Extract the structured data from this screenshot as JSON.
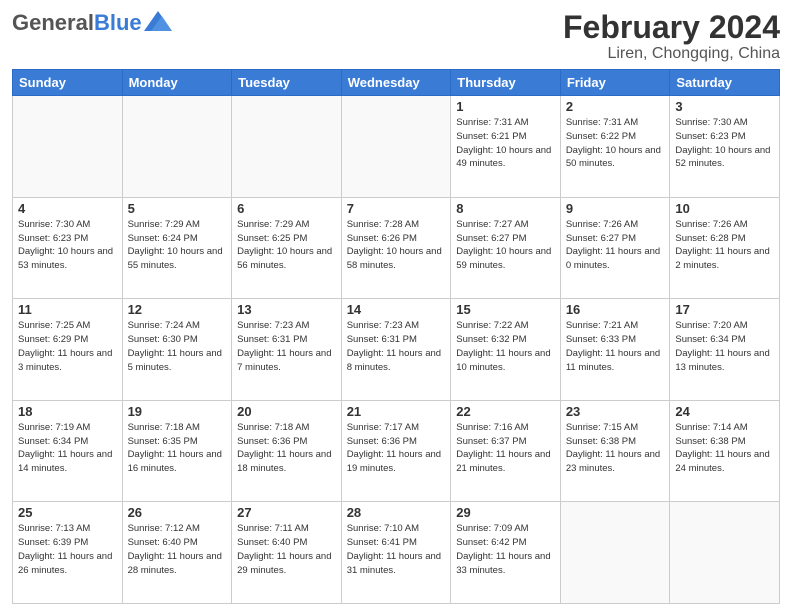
{
  "header": {
    "logo_general": "General",
    "logo_blue": "Blue",
    "title": "February 2024",
    "subtitle": "Liren, Chongqing, China"
  },
  "days_of_week": [
    "Sunday",
    "Monday",
    "Tuesday",
    "Wednesday",
    "Thursday",
    "Friday",
    "Saturday"
  ],
  "weeks": [
    {
      "alt": false,
      "days": [
        {
          "num": "",
          "info": "",
          "empty": true
        },
        {
          "num": "",
          "info": "",
          "empty": true
        },
        {
          "num": "",
          "info": "",
          "empty": true
        },
        {
          "num": "",
          "info": "",
          "empty": true
        },
        {
          "num": "1",
          "info": "Sunrise: 7:31 AM\nSunset: 6:21 PM\nDaylight: 10 hours\nand 49 minutes."
        },
        {
          "num": "2",
          "info": "Sunrise: 7:31 AM\nSunset: 6:22 PM\nDaylight: 10 hours\nand 50 minutes."
        },
        {
          "num": "3",
          "info": "Sunrise: 7:30 AM\nSunset: 6:23 PM\nDaylight: 10 hours\nand 52 minutes."
        }
      ]
    },
    {
      "alt": true,
      "days": [
        {
          "num": "4",
          "info": "Sunrise: 7:30 AM\nSunset: 6:23 PM\nDaylight: 10 hours\nand 53 minutes."
        },
        {
          "num": "5",
          "info": "Sunrise: 7:29 AM\nSunset: 6:24 PM\nDaylight: 10 hours\nand 55 minutes."
        },
        {
          "num": "6",
          "info": "Sunrise: 7:29 AM\nSunset: 6:25 PM\nDaylight: 10 hours\nand 56 minutes."
        },
        {
          "num": "7",
          "info": "Sunrise: 7:28 AM\nSunset: 6:26 PM\nDaylight: 10 hours\nand 58 minutes."
        },
        {
          "num": "8",
          "info": "Sunrise: 7:27 AM\nSunset: 6:27 PM\nDaylight: 10 hours\nand 59 minutes."
        },
        {
          "num": "9",
          "info": "Sunrise: 7:26 AM\nSunset: 6:27 PM\nDaylight: 11 hours\nand 0 minutes."
        },
        {
          "num": "10",
          "info": "Sunrise: 7:26 AM\nSunset: 6:28 PM\nDaylight: 11 hours\nand 2 minutes."
        }
      ]
    },
    {
      "alt": false,
      "days": [
        {
          "num": "11",
          "info": "Sunrise: 7:25 AM\nSunset: 6:29 PM\nDaylight: 11 hours\nand 3 minutes."
        },
        {
          "num": "12",
          "info": "Sunrise: 7:24 AM\nSunset: 6:30 PM\nDaylight: 11 hours\nand 5 minutes."
        },
        {
          "num": "13",
          "info": "Sunrise: 7:23 AM\nSunset: 6:31 PM\nDaylight: 11 hours\nand 7 minutes."
        },
        {
          "num": "14",
          "info": "Sunrise: 7:23 AM\nSunset: 6:31 PM\nDaylight: 11 hours\nand 8 minutes."
        },
        {
          "num": "15",
          "info": "Sunrise: 7:22 AM\nSunset: 6:32 PM\nDaylight: 11 hours\nand 10 minutes."
        },
        {
          "num": "16",
          "info": "Sunrise: 7:21 AM\nSunset: 6:33 PM\nDaylight: 11 hours\nand 11 minutes."
        },
        {
          "num": "17",
          "info": "Sunrise: 7:20 AM\nSunset: 6:34 PM\nDaylight: 11 hours\nand 13 minutes."
        }
      ]
    },
    {
      "alt": true,
      "days": [
        {
          "num": "18",
          "info": "Sunrise: 7:19 AM\nSunset: 6:34 PM\nDaylight: 11 hours\nand 14 minutes."
        },
        {
          "num": "19",
          "info": "Sunrise: 7:18 AM\nSunset: 6:35 PM\nDaylight: 11 hours\nand 16 minutes."
        },
        {
          "num": "20",
          "info": "Sunrise: 7:18 AM\nSunset: 6:36 PM\nDaylight: 11 hours\nand 18 minutes."
        },
        {
          "num": "21",
          "info": "Sunrise: 7:17 AM\nSunset: 6:36 PM\nDaylight: 11 hours\nand 19 minutes."
        },
        {
          "num": "22",
          "info": "Sunrise: 7:16 AM\nSunset: 6:37 PM\nDaylight: 11 hours\nand 21 minutes."
        },
        {
          "num": "23",
          "info": "Sunrise: 7:15 AM\nSunset: 6:38 PM\nDaylight: 11 hours\nand 23 minutes."
        },
        {
          "num": "24",
          "info": "Sunrise: 7:14 AM\nSunset: 6:38 PM\nDaylight: 11 hours\nand 24 minutes."
        }
      ]
    },
    {
      "alt": false,
      "days": [
        {
          "num": "25",
          "info": "Sunrise: 7:13 AM\nSunset: 6:39 PM\nDaylight: 11 hours\nand 26 minutes."
        },
        {
          "num": "26",
          "info": "Sunrise: 7:12 AM\nSunset: 6:40 PM\nDaylight: 11 hours\nand 28 minutes."
        },
        {
          "num": "27",
          "info": "Sunrise: 7:11 AM\nSunset: 6:40 PM\nDaylight: 11 hours\nand 29 minutes."
        },
        {
          "num": "28",
          "info": "Sunrise: 7:10 AM\nSunset: 6:41 PM\nDaylight: 11 hours\nand 31 minutes."
        },
        {
          "num": "29",
          "info": "Sunrise: 7:09 AM\nSunset: 6:42 PM\nDaylight: 11 hours\nand 33 minutes."
        },
        {
          "num": "",
          "info": "",
          "empty": true
        },
        {
          "num": "",
          "info": "",
          "empty": true
        }
      ]
    }
  ]
}
